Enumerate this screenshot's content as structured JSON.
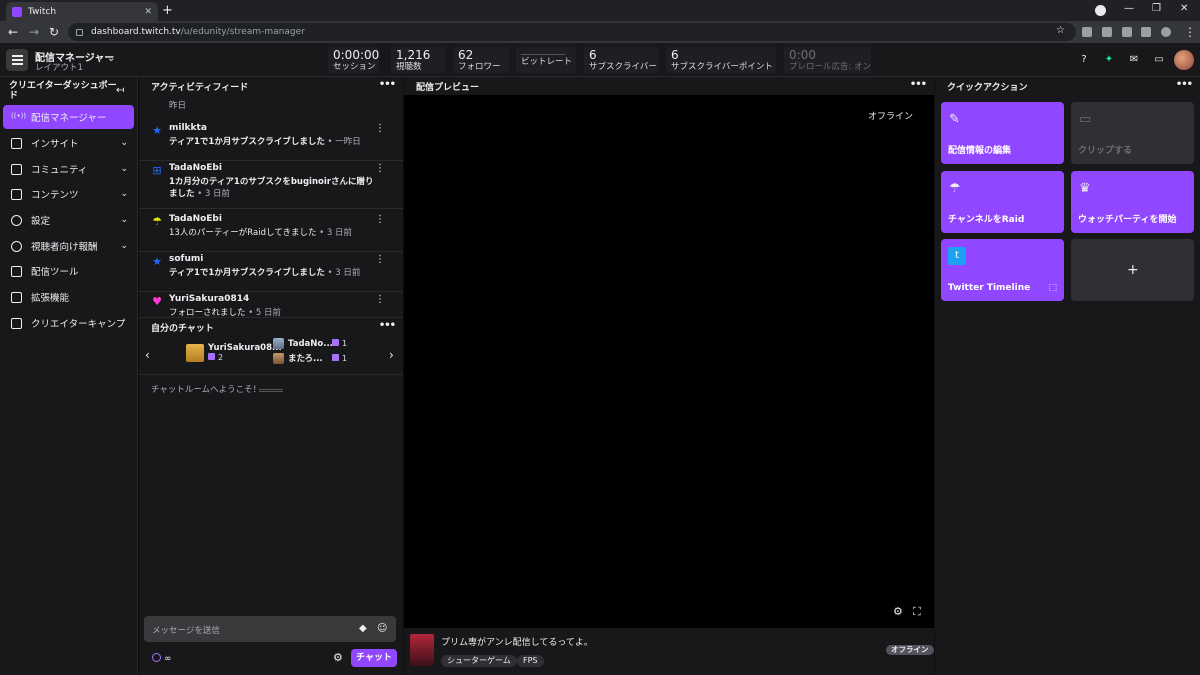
{
  "browser": {
    "tab_title": "Twitch",
    "url_host": "dashboard.twitch.tv",
    "url_path": "/u/edunity/stream-manager"
  },
  "topbar": {
    "layout_title": "配信マネージャー",
    "layout_sub": "レイアウト1",
    "stats": [
      {
        "value": "0:00:00",
        "label": "セッション"
      },
      {
        "value": "1,216",
        "label": "視聴数"
      },
      {
        "value": "62",
        "label": "フォロワー"
      },
      {
        "value": "",
        "label": "ビットレート"
      },
      {
        "value": "6",
        "label": "サブスクライバー"
      },
      {
        "value": "6",
        "label": "サブスクライバーポイント"
      },
      {
        "value": "0:00",
        "label": "プレロール広告: オン"
      }
    ]
  },
  "sidebar": {
    "title": "クリエイターダッシュボード",
    "items": [
      {
        "label": "配信マネージャー"
      },
      {
        "label": "インサイト"
      },
      {
        "label": "コミュニティ"
      },
      {
        "label": "コンテンツ"
      },
      {
        "label": "設定"
      },
      {
        "label": "視聴者向け報酬"
      },
      {
        "label": "配信ツール"
      },
      {
        "label": "拡張機能"
      },
      {
        "label": "クリエイターキャンプ"
      }
    ]
  },
  "activity": {
    "header": "アクティビティフィード",
    "group_label": "昨日",
    "items": [
      {
        "user": "milkkta",
        "text": "ティア1で1か月サブスクライブしました",
        "time": " • 一昨日",
        "icon": "star-icon"
      },
      {
        "user": "TadaNoEbi",
        "text": "1カ月分のティア1のサブスクをbuginoirさんに贈りました",
        "time": " • 3 日前",
        "icon": "gift-icon"
      },
      {
        "user": "TadaNoEbi",
        "text": "13人のパーティーがRaidしてきました",
        "time": " • 3 日前",
        "icon": "raid-icon"
      },
      {
        "user": "sofumi",
        "text": "ティア1で1か月サブスクライブしました",
        "time": " • 3 日前",
        "icon": "star-icon"
      },
      {
        "user": "YuriSakura0814",
        "text": "フォローされました",
        "time": " • 5 日前",
        "icon": "heart-icon"
      }
    ]
  },
  "chat": {
    "header": "自分のチャット",
    "gifters": [
      {
        "name": "YuriSakura08...",
        "count": "2"
      },
      {
        "name": "TadaNo...",
        "count": "1"
      },
      {
        "name": "またろ...",
        "count": "1"
      }
    ],
    "welcome": "チャットルームへようこそ！",
    "input_placeholder": "メッセージを送信",
    "points": "∞",
    "send_label": "チャット"
  },
  "preview": {
    "header": "配信プレビュー",
    "offline_text": "オフライン",
    "stream_title": "プリム専がアンレ配信してるってよ。",
    "tags": [
      "シューターゲーム",
      "FPS"
    ],
    "status_badge": "オフライン"
  },
  "quick_actions": {
    "header": "クイックアクション",
    "tiles": [
      {
        "label": "配信情報の編集",
        "icon": "pencil-icon"
      },
      {
        "label": "クリップする",
        "icon": "clapper-icon"
      },
      {
        "label": "チャンネルをRaid",
        "icon": "parachute-icon"
      },
      {
        "label": "ウォッチパーティを開始",
        "icon": "crown-icon"
      },
      {
        "label": "Twitter Timeline",
        "icon": "twitter-icon"
      },
      {
        "label": "+",
        "icon": "plus-icon"
      }
    ]
  },
  "colors": {
    "accent": "#9147ff",
    "background": "#0e0e10",
    "panel": "#18181b"
  }
}
